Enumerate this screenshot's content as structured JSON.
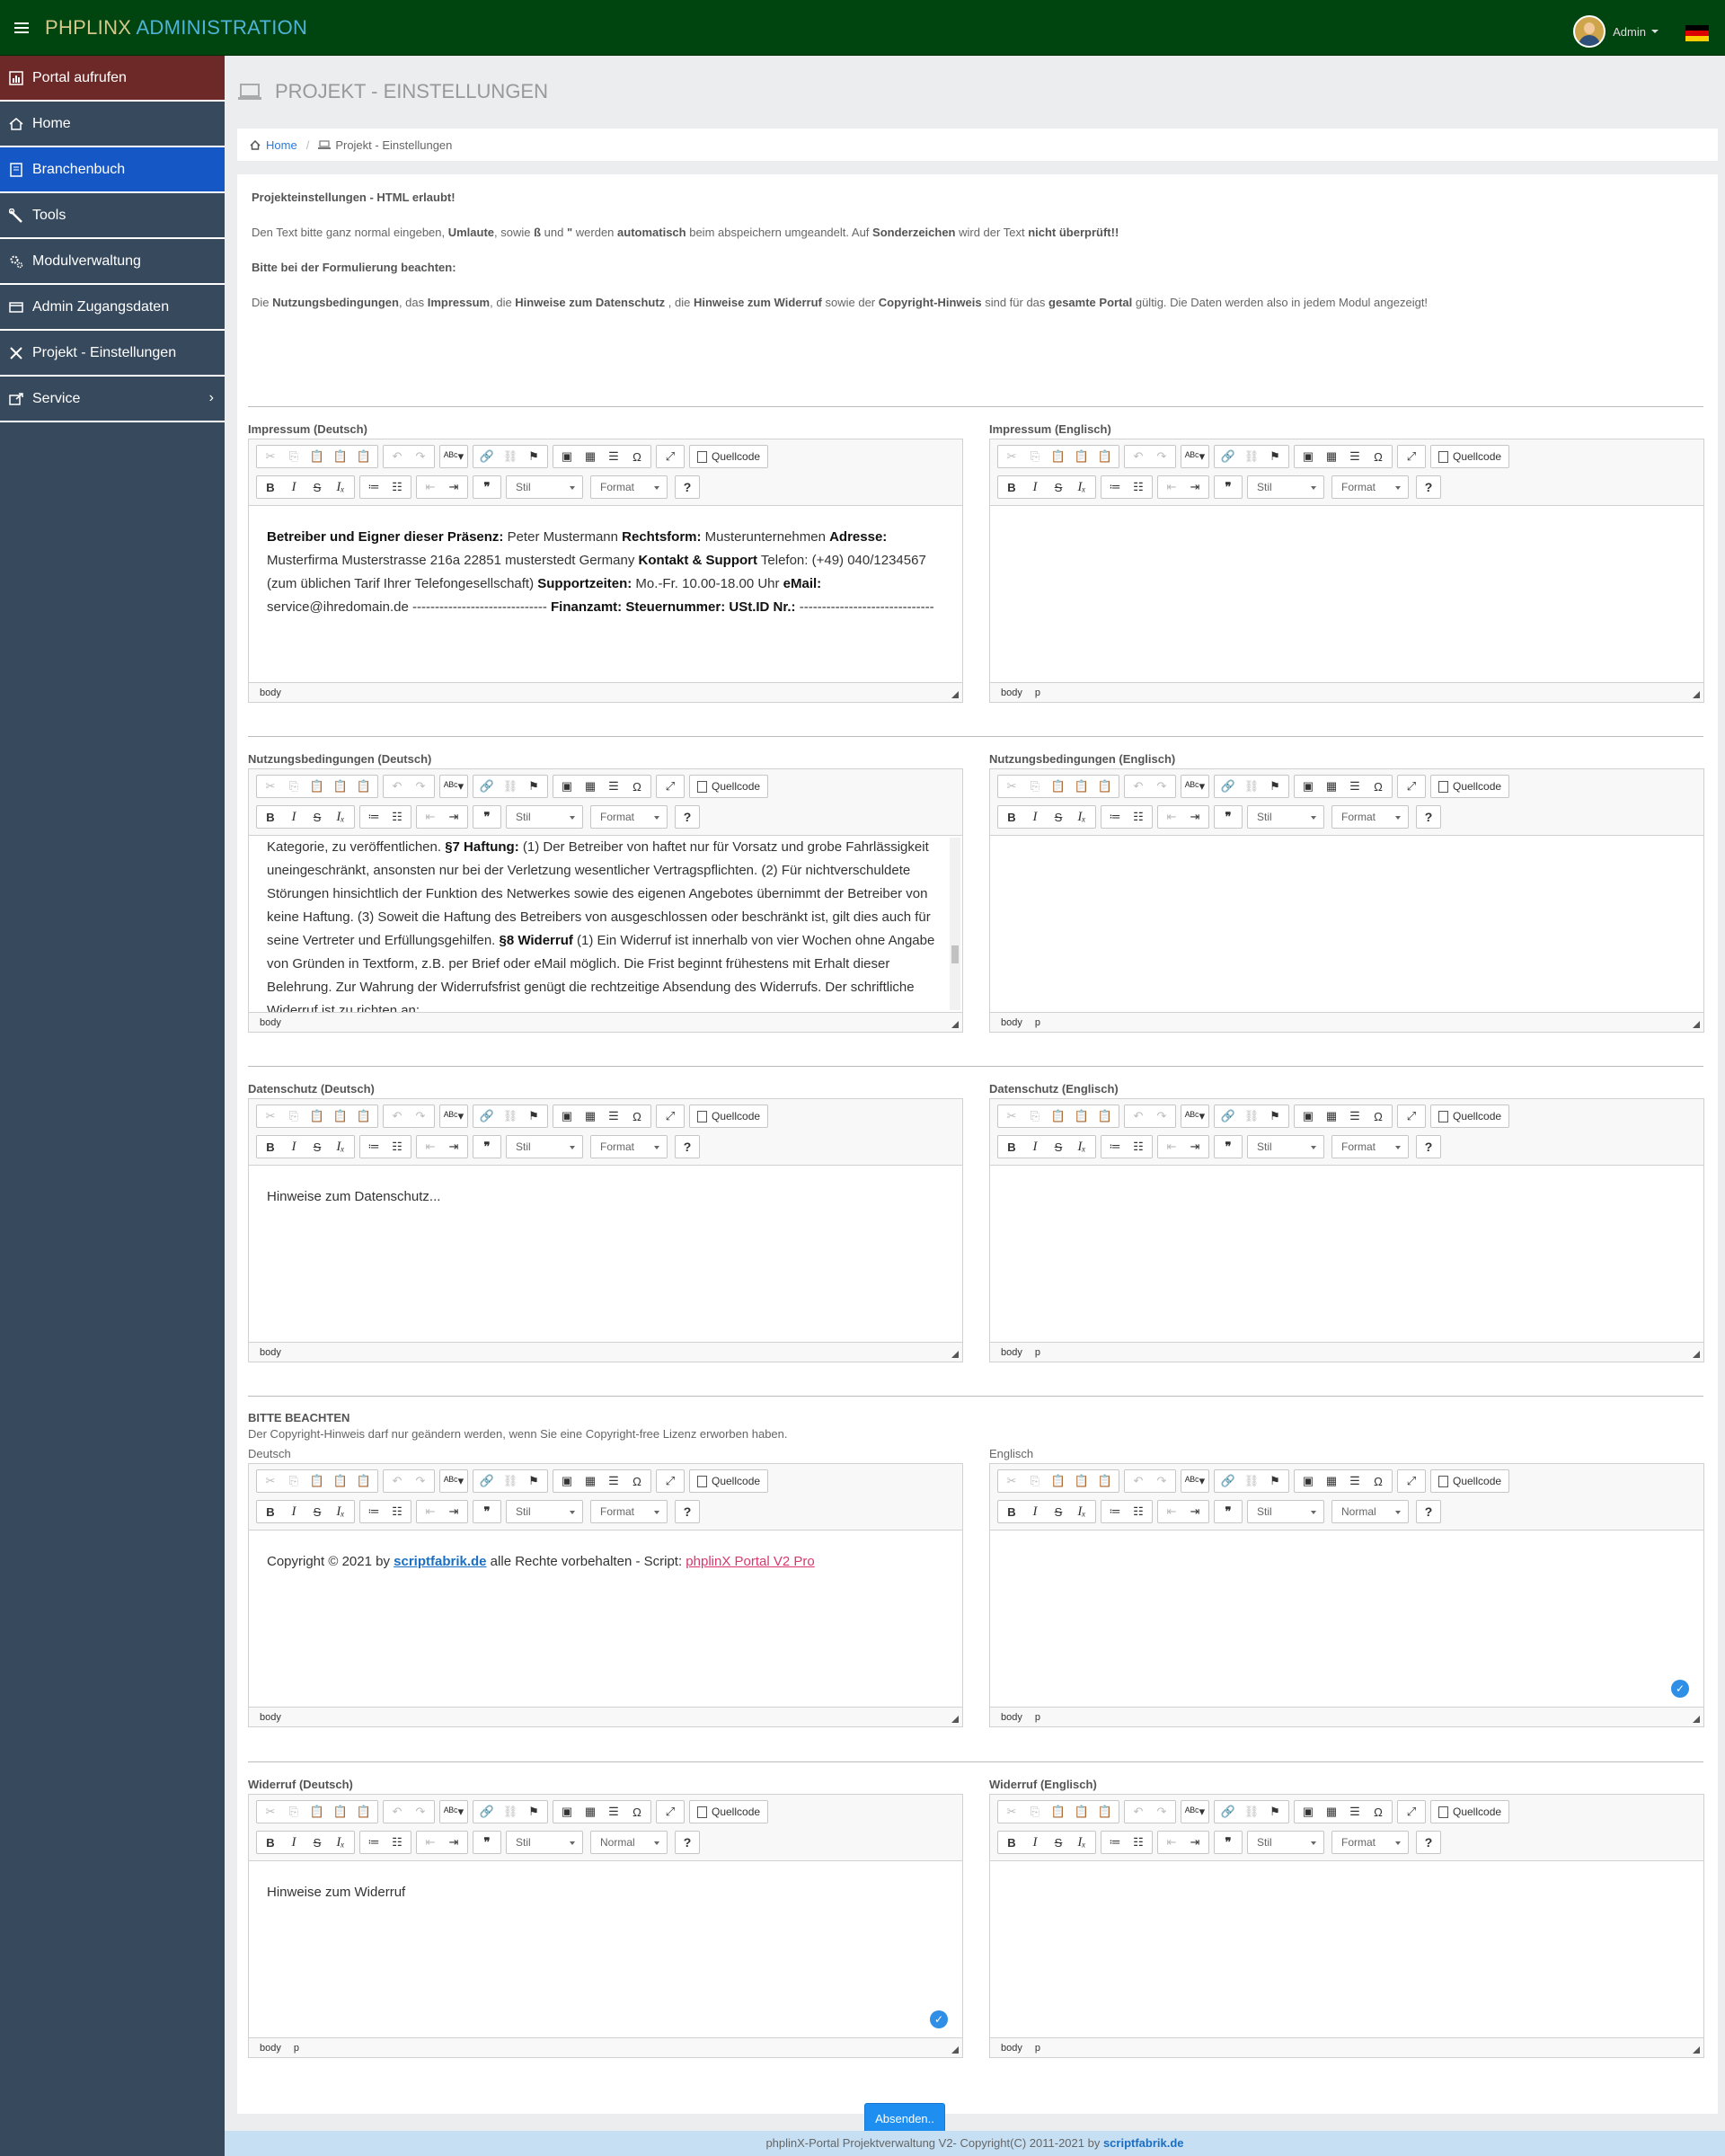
{
  "header": {
    "brand_part1": "PHPLINX",
    "brand_part2": "ADMINISTRATION",
    "user": "Admin",
    "flag_colors": [
      "#000000",
      "#dd0000",
      "#ffce00"
    ]
  },
  "sidebar": {
    "items": [
      {
        "label": "Portal aufrufen",
        "icon": "chart-icon"
      },
      {
        "label": "Home",
        "icon": "home-icon"
      },
      {
        "label": "Branchenbuch",
        "icon": "book-icon"
      },
      {
        "label": "Tools",
        "icon": "wrench-icon"
      },
      {
        "label": "Modulverwaltung",
        "icon": "cogs-icon"
      },
      {
        "label": "Admin Zugangsdaten",
        "icon": "card-icon"
      },
      {
        "label": "Projekt - Einstellungen",
        "icon": "tools-icon"
      },
      {
        "label": "Service",
        "icon": "share-icon",
        "arrow": "›"
      }
    ]
  },
  "page": {
    "title": "PROJEKT - EINSTELLUNGEN"
  },
  "breadcrumb": {
    "home": "Home",
    "sep": "/",
    "current": "Projekt - Einstellungen"
  },
  "notes": {
    "heading": "Projekteinstellungen - HTML erlaubt!",
    "line1": [
      "Den Text bitte ganz normal eingeben, ",
      "Umlaute",
      ", sowie ",
      "ß",
      " und ",
      "\"",
      " werden ",
      "automatisch",
      " beim abspeichern umgeandelt. Auf ",
      "Sonderzeichen",
      " wird der Text ",
      "nicht überprüft!!"
    ],
    "heading2": "Bitte bei der Formulierung beachten:",
    "line2": [
      "Die ",
      "Nutzungsbedingungen",
      ", das ",
      "Impressum",
      ", die ",
      "Hinweise zum Datenschutz",
      " , die ",
      "Hinweise zum Widerruf",
      " sowie der ",
      "Copyright-Hinweis",
      " sind für das ",
      "gesamte Portal",
      " gültig. Die Daten werden also in jedem Modul angezeigt!"
    ]
  },
  "toolbar": {
    "source_label": "Quellcode",
    "style_label": "Stil",
    "format_label": "Format",
    "normal_label": "Normal",
    "help_label": "?"
  },
  "editors": {
    "impressum_de": {
      "label": "Impressum (Deutsch)",
      "path": [
        "body"
      ],
      "content": [
        [
          "b",
          "Betreiber und Eigner dieser Präsenz:"
        ],
        [
          "t",
          " Peter Mustermann "
        ],
        [
          "b",
          "Rechtsform:"
        ],
        [
          "t",
          " Musterunternehmen "
        ],
        [
          "b",
          "Adresse:"
        ],
        [
          "t",
          " Musterfirma Musterstrasse 216a 22851 musterstedt Germany "
        ],
        [
          "b",
          "Kontakt & Support"
        ],
        [
          "t",
          " Telefon: (+49) 040/1234567 (zum üblichen Tarif Ihrer Telefongesellschaft) "
        ],
        [
          "b",
          "Supportzeiten:"
        ],
        [
          "t",
          " Mo.-Fr. 10.00-18.00 Uhr "
        ],
        [
          "b",
          "eMail:"
        ],
        [
          "t",
          " service@ihredomain.de ------------------------------ "
        ],
        [
          "b",
          "Finanzamt: Steuernummer: USt.ID Nr.:"
        ],
        [
          "t",
          " ------------------------------"
        ]
      ]
    },
    "impressum_en": {
      "label": "Impressum (Englisch)",
      "path": [
        "body",
        "p"
      ],
      "content": []
    },
    "nutzung_de": {
      "label": "Nutzungsbedingungen (Deutsch)",
      "path": [
        "body"
      ],
      "content": [
        [
          "t",
          "Kategorie, zu veröffentlichen. "
        ],
        [
          "b",
          "§7 Haftung:"
        ],
        [
          "t",
          " (1) Der Betreiber von haftet nur für Vorsatz und grobe Fahrlässigkeit uneingeschränkt, ansonsten nur bei der Verletzung wesentlicher Vertragspflichten. (2) Für nichtverschuldete Störungen hinsichtlich der Funktion des Netwerkes sowie des eigenen Angebotes übernimmt der Betreiber von keine Haftung. (3) Soweit die Haftung des Betreibers von ausgeschlossen oder beschränkt ist, gilt dies auch für seine Vertreter und Erfüllungsgehilfen. "
        ],
        [
          "b",
          "§8 Widerruf"
        ],
        [
          "t",
          " (1) Ein Widerruf ist innerhalb von vier Wochen ohne Angabe von Gründen in Textform, z.B. per Brief oder eMail möglich. Die Frist beginnt frühestens mit Erhalt dieser Belehrung. Zur Wahrung der Widerrufsfrist genügt die rechtzeitige Absendung des Widerrufs. Der schriftliche Widerruf ist zu richten an:"
        ]
      ]
    },
    "nutzung_en": {
      "label": "Nutzungsbedingungen (Englisch)",
      "path": [
        "body",
        "p"
      ],
      "content": []
    },
    "datenschutz_de": {
      "label": "Datenschutz (Deutsch)",
      "path": [
        "body"
      ],
      "content": [
        [
          "t",
          "Hinweise zum Datenschutz..."
        ]
      ]
    },
    "datenschutz_en": {
      "label": "Datenschutz (Englisch)",
      "path": [
        "body",
        "p"
      ],
      "content": []
    },
    "copyright_de": {
      "label": "Deutsch",
      "path": [
        "body"
      ],
      "content": [
        [
          "t",
          "Copyright © 2021 by "
        ],
        [
          "l1",
          "scriptfabrik.de"
        ],
        [
          "t",
          " alle Rechte vorbehalten - Script: "
        ],
        [
          "l2",
          "phplinX Portal V2 Pro"
        ]
      ]
    },
    "copyright_en": {
      "label": "Englisch",
      "path": [
        "body",
        "p"
      ],
      "content": []
    },
    "widerruf_de": {
      "label": "Widerruf (Deutsch)",
      "path": [
        "body",
        "p"
      ],
      "content": [
        [
          "t",
          "Hinweise zum Widerruf"
        ]
      ]
    },
    "widerruf_en": {
      "label": "Widerruf (Englisch)",
      "path": [
        "body",
        "p"
      ],
      "content": []
    }
  },
  "copyright_notice": {
    "title": "BITTE BEACHTEN",
    "text": "Der Copyright-Hinweis darf nur geändern werden, wenn Sie eine Copyright-free Lizenz erworben haben."
  },
  "submit_label": "Absenden..",
  "footer": {
    "text": "phplinX-Portal Projektverwaltung V2- Copyright(C) 2011-2021 by ",
    "link": "scriptfabrik.de"
  }
}
